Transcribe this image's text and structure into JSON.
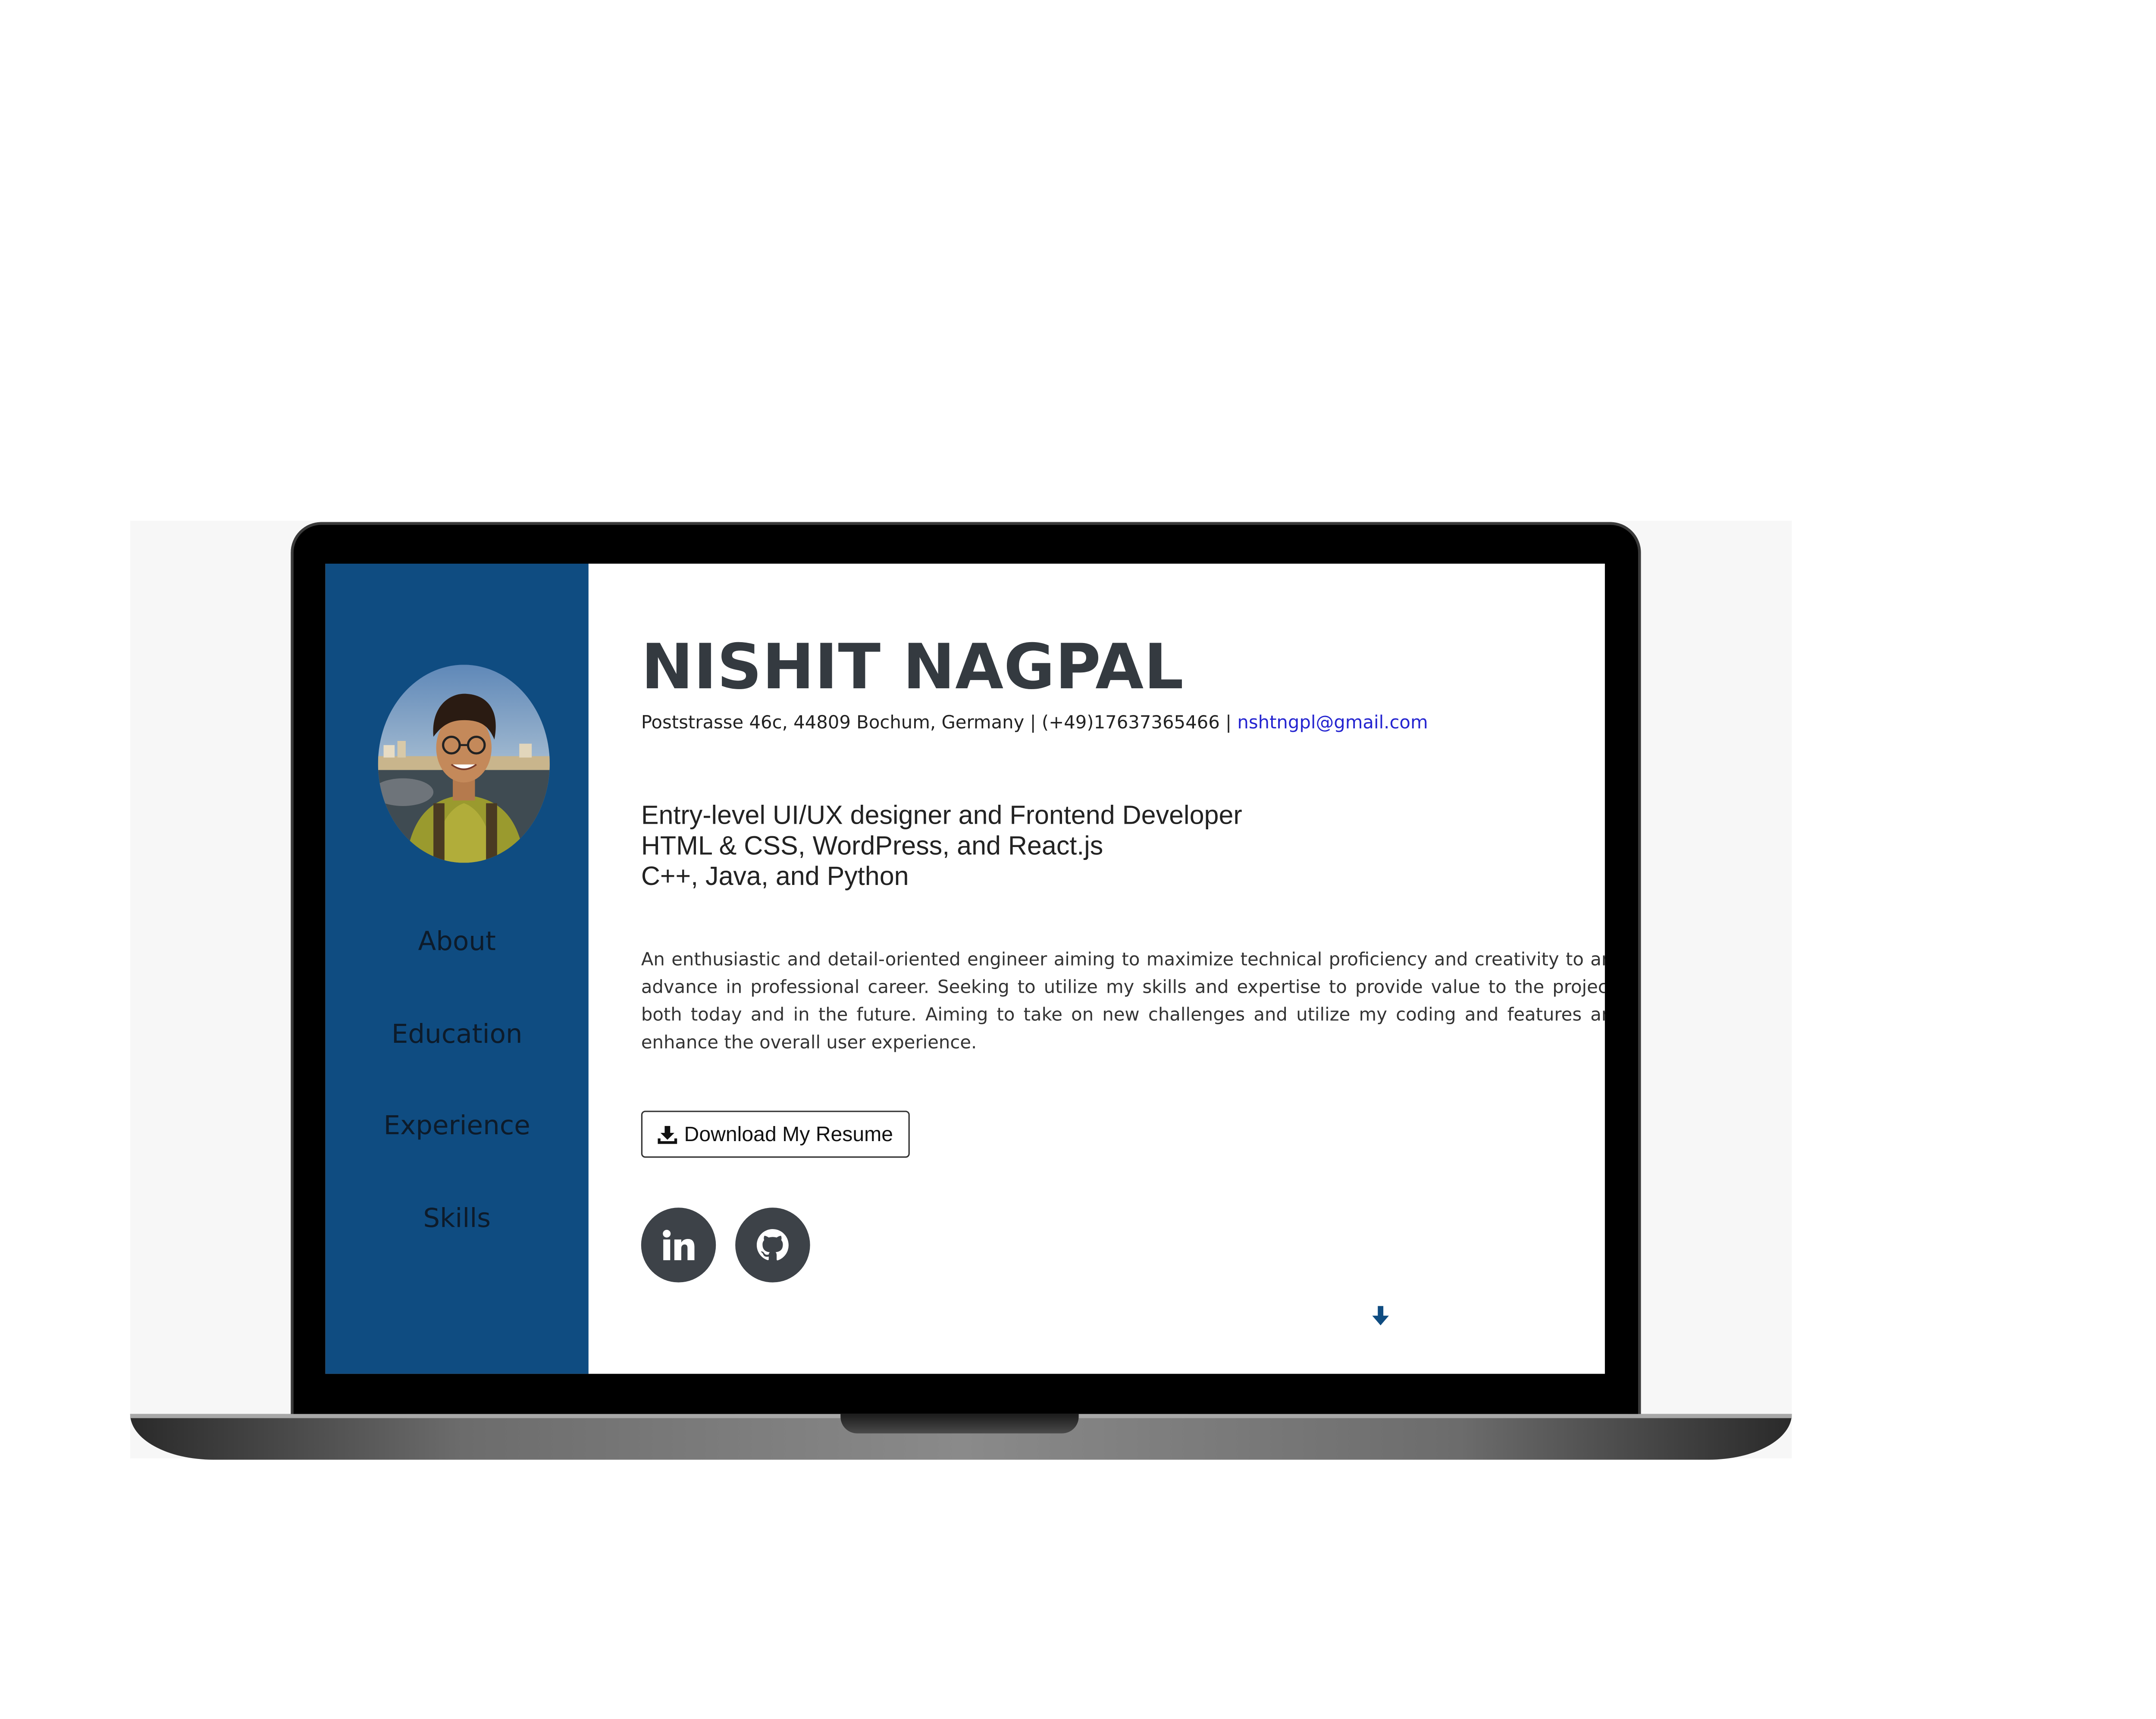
{
  "sidebar": {
    "nav": [
      {
        "label": "About"
      },
      {
        "label": "Education"
      },
      {
        "label": "Experience"
      },
      {
        "label": "Skills"
      }
    ]
  },
  "header": {
    "name": "NISHIT NAGPAL",
    "address_phone": "Poststrasse 46c, 44809 Bochum, Germany | (+49)17637365466 | ",
    "email": "nshtngpl@gmail.com"
  },
  "tagline": {
    "line1": "Entry-level UI/UX designer and Frontend Developer",
    "line2": "HTML & CSS, WordPress, and React.js",
    "line3": "C++, Java, and Python"
  },
  "summary": "An enthusiastic and detail-oriented engineer aiming to maximize technical proficiency and creativity to and advance in professional career. Seeking to utilize my skills and expertise to provide value to the projects both today and in the future. Aiming to take on new challenges and utilize my coding and features and enhance the overall user experience.",
  "resume_button": {
    "label": "Download My Resume"
  },
  "social": [
    {
      "icon": "linkedin-icon"
    },
    {
      "icon": "github-icon"
    }
  ],
  "colors": {
    "sidebar": "#0f4c81",
    "heading": "#343a40",
    "social_bg": "#3d4248",
    "link": "#2424d0"
  }
}
